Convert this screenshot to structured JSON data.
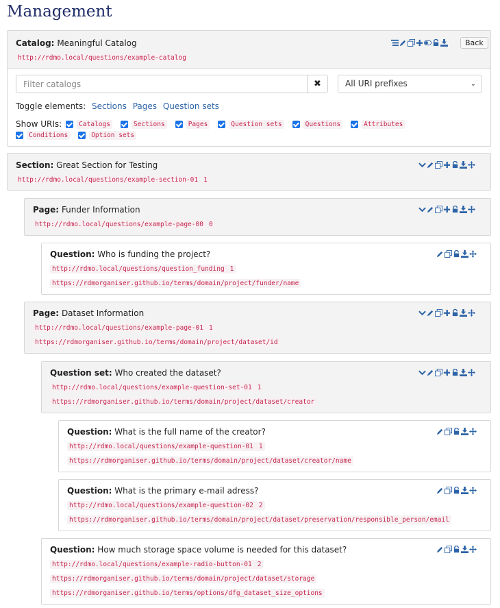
{
  "page": {
    "title": "Management"
  },
  "catalog": {
    "type_label": "Catalog:",
    "title": "Meaningful Catalog",
    "uri": "http://rdmo.local/questions/example-catalog",
    "back_label": "Back",
    "filter_placeholder": "Filter catalogs",
    "clear_symbol": "✖",
    "prefix_select": "All URI prefixes",
    "toggle_label": "Toggle elements:",
    "toggle_links": [
      "Sections",
      "Pages",
      "Question sets"
    ],
    "show_uris_label": "Show URIs:",
    "show_uris": [
      "Catalogs",
      "Sections",
      "Pages",
      "Question sets",
      "Questions",
      "Attributes",
      "Conditions",
      "Option sets"
    ]
  },
  "elements": [
    {
      "type_label": "Section:",
      "title": "Great Section for Testing",
      "uris": [
        [
          "http://rdmo.local/questions/example-section-01",
          "1"
        ]
      ]
    },
    {
      "type_label": "Page:",
      "title": "Funder Information",
      "uris": [
        [
          "http://rdmo.local/questions/example-page-00",
          "0"
        ]
      ]
    },
    {
      "type_label": "Question:",
      "title": "Who is funding the project?",
      "uris": [
        [
          "http://rdmo.local/questions/question_funding",
          "1"
        ],
        [
          "https://rdmorganiser.github.io/terms/domain/project/funder/name",
          ""
        ]
      ]
    },
    {
      "type_label": "Page:",
      "title": "Dataset Information",
      "uris": [
        [
          "http://rdmo.local/questions/example-page-01",
          "1"
        ],
        [
          "https://rdmorganiser.github.io/terms/domain/project/dataset/id",
          ""
        ]
      ]
    },
    {
      "type_label": "Question set:",
      "title": "Who created the dataset?",
      "uris": [
        [
          "http://rdmo.local/questions/example-question-set-01",
          "1"
        ],
        [
          "https://rdmorganiser.github.io/terms/domain/project/dataset/creator",
          ""
        ]
      ]
    },
    {
      "type_label": "Question:",
      "title": "What is the full name of the creator?",
      "uris": [
        [
          "http://rdmo.local/questions/example-question-01",
          "1"
        ],
        [
          "https://rdmorganiser.github.io/terms/domain/project/dataset/creator/name",
          ""
        ]
      ]
    },
    {
      "type_label": "Question:",
      "title": "What is the primary e-mail adress?",
      "uris": [
        [
          "http://rdmo.local/questions/example-question-02",
          "2"
        ],
        [
          "https://rdmorganiser.github.io/terms/domain/project/dataset/preservation/responsible_person/email",
          ""
        ]
      ]
    },
    {
      "type_label": "Question:",
      "title": "How much storage space volume is needed for this dataset?",
      "uris": [
        [
          "http://rdmo.local/questions/example-radio-button-01",
          "2"
        ],
        [
          "https://rdmorganiser.github.io/terms/domain/project/dataset/storage",
          ""
        ],
        [
          "https://rdmorganiser.github.io/terms/options/dfg_dataset_size_options",
          ""
        ]
      ]
    }
  ],
  "icons": {
    "catalog_toolbar": [
      "list-icon",
      "pencil-icon",
      "copy-icon",
      "plus-icon",
      "toggle-icon",
      "lock-icon",
      "download-icon"
    ],
    "container_toolbar": [
      "chevron-down-icon",
      "pencil-icon",
      "copy-icon",
      "plus-icon",
      "lock-icon",
      "download-icon",
      "move-icon"
    ],
    "question_toolbar": [
      "pencil-icon",
      "copy-icon",
      "lock-icon",
      "download-icon",
      "move-icon"
    ]
  },
  "colors": {
    "link": "#2c63a6",
    "code": "#c7254e",
    "title": "#1f2d68",
    "checkbox": "#1a73e8"
  }
}
